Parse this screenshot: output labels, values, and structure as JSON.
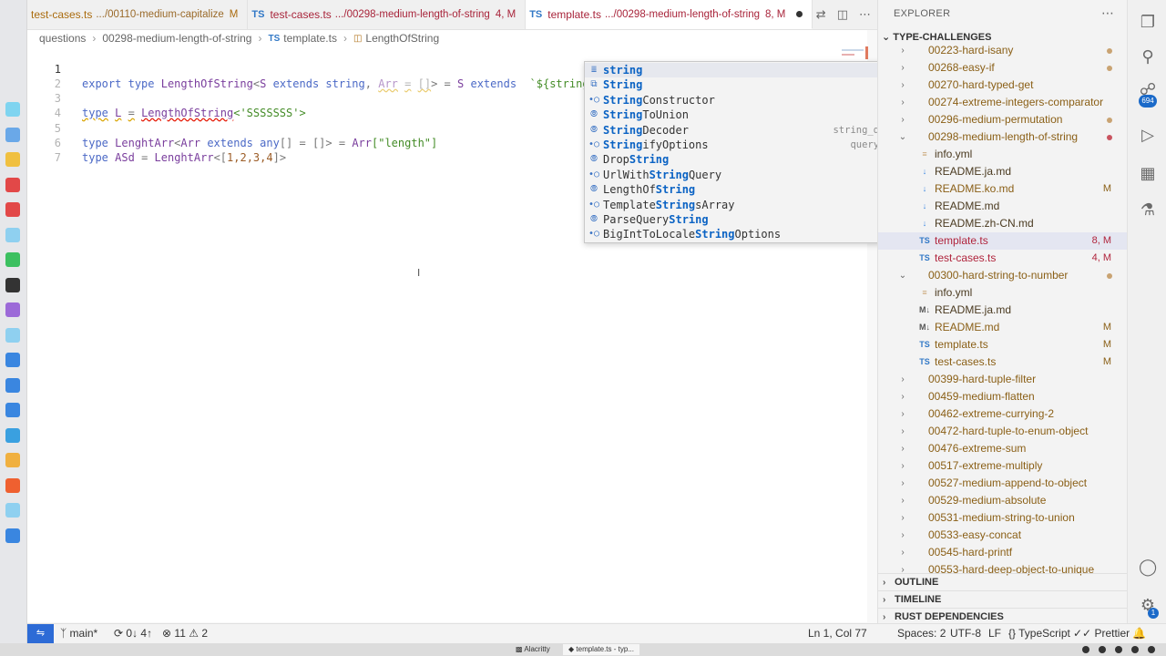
{
  "tabs": [
    {
      "name": "test-cases.ts",
      "path": ".../00110-medium-capitalize",
      "status": "M",
      "active": false
    },
    {
      "name": "test-cases.ts",
      "path": ".../00298-medium-length-of-string",
      "status": "4, M",
      "active": false
    },
    {
      "name": "template.ts",
      "path": ".../00298-medium-length-of-string",
      "status": "8, M",
      "active": true
    }
  ],
  "ts_badge": "TS",
  "breadcrumb": [
    "questions",
    "00298-medium-length-of-string",
    "template.ts",
    "LengthOfString"
  ],
  "editor": {
    "line_numbers": [
      "1",
      "2",
      "3",
      "4",
      "5",
      "6",
      "7"
    ],
    "line1": {
      "export": "export",
      "type": "type",
      "name": "LengthOfString",
      "lt": "<",
      "s": "S",
      "extends": "extends",
      "string": "string",
      "comma": ",",
      "arr": "Arr",
      "eq": "=",
      "brackets": "[]",
      "gt": ">",
      "eq2": "=",
      "s2": "S",
      "extends2": "extends",
      "tpl": "`${string",
      "tick": "`"
    },
    "line3": {
      "type": "type",
      "name": "L",
      "eq": "=",
      "call": "LengthOfString",
      "arg": "<'SSSSSSS'>"
    },
    "line5": {
      "type": "type",
      "name": "LenghtArr",
      "lt": "<",
      "arr": "Arr",
      "extends": "extends",
      "any": "any",
      "rest": "[] = []> = ",
      "arr2": "Arr",
      "idx": "[\"length\"]"
    },
    "line6": {
      "type": "type",
      "name": "ASd",
      "eq": "=",
      "call": "LenghtArr",
      "lt": "<[",
      "nums": "1,2,3,4",
      "gt": "]>"
    }
  },
  "suggestions": [
    {
      "pre": "",
      "bold": "string",
      "post": "",
      "icon": "keyword-icon",
      "detail": ""
    },
    {
      "pre": "",
      "bold": "String",
      "post": "",
      "icon": "interface-icon",
      "detail": ""
    },
    {
      "pre": "",
      "bold": "String",
      "post": "Constructor",
      "icon": "variable-icon",
      "detail": ""
    },
    {
      "pre": "",
      "bold": "String",
      "post": "ToUnion",
      "icon": "type-icon",
      "detail": ""
    },
    {
      "pre": "",
      "bold": "String",
      "post": "Decoder",
      "icon": "type-icon",
      "detail": "string_decoder"
    },
    {
      "pre": "",
      "bold": "String",
      "post": "ifyOptions",
      "icon": "variable-icon",
      "detail": "querystring"
    },
    {
      "pre": "Drop",
      "bold": "String",
      "post": "",
      "icon": "type-icon",
      "detail": ""
    },
    {
      "pre": "UrlWith",
      "bold": "String",
      "post": "Query",
      "icon": "variable-icon",
      "detail": "url"
    },
    {
      "pre": "LengthOf",
      "bold": "String",
      "post": "",
      "icon": "type-icon",
      "detail": ""
    },
    {
      "pre": "Template",
      "bold": "String",
      "post": "sArray",
      "icon": "variable-icon",
      "detail": ""
    },
    {
      "pre": "ParseQuery",
      "bold": "String",
      "post": "",
      "icon": "type-icon",
      "detail": ""
    },
    {
      "pre": "BigIntToLocale",
      "bold": "String",
      "post": "Options",
      "icon": "variable-icon",
      "detail": ""
    }
  ],
  "explorer": {
    "title": "EXPLORER",
    "root": "TYPE-CHALLENGES",
    "items": [
      {
        "label": "00223-hard-isany",
        "kind": "folder",
        "status": "",
        "dot": true
      },
      {
        "label": "00268-easy-if",
        "kind": "folder",
        "status": "",
        "dot": true
      },
      {
        "label": "00270-hard-typed-get",
        "kind": "folder",
        "status": "",
        "dot": false
      },
      {
        "label": "00274-extreme-integers-comparator",
        "kind": "folder",
        "status": "",
        "dot": false
      },
      {
        "label": "00296-medium-permutation",
        "kind": "folder",
        "status": "",
        "dot": true
      },
      {
        "label": "00298-medium-length-of-string",
        "kind": "folder-open",
        "status": "",
        "dot": true
      },
      {
        "label": "info.yml",
        "kind": "yml",
        "status": ""
      },
      {
        "label": "README.ja.md",
        "kind": "md",
        "status": ""
      },
      {
        "label": "README.ko.md",
        "kind": "md",
        "status": "M"
      },
      {
        "label": "README.md",
        "kind": "md",
        "status": ""
      },
      {
        "label": "README.zh-CN.md",
        "kind": "md",
        "status": ""
      },
      {
        "label": "template.ts",
        "kind": "ts",
        "status": "8, M"
      },
      {
        "label": "test-cases.ts",
        "kind": "ts",
        "status": "4, M"
      },
      {
        "label": "00300-hard-string-to-number",
        "kind": "folder-open",
        "status": "",
        "dot": true
      },
      {
        "label": "info.yml",
        "kind": "yml",
        "status": ""
      },
      {
        "label": "README.ja.md",
        "kind": "mdicon",
        "status": ""
      },
      {
        "label": "README.md",
        "kind": "mdicon",
        "status": "M"
      },
      {
        "label": "template.ts",
        "kind": "ts",
        "status": "M"
      },
      {
        "label": "test-cases.ts",
        "kind": "ts",
        "status": "M"
      },
      {
        "label": "00399-hard-tuple-filter",
        "kind": "folder",
        "status": ""
      },
      {
        "label": "00459-medium-flatten",
        "kind": "folder",
        "status": ""
      },
      {
        "label": "00462-extreme-currying-2",
        "kind": "folder",
        "status": ""
      },
      {
        "label": "00472-hard-tuple-to-enum-object",
        "kind": "folder",
        "status": ""
      },
      {
        "label": "00476-extreme-sum",
        "kind": "folder",
        "status": ""
      },
      {
        "label": "00517-extreme-multiply",
        "kind": "folder",
        "status": ""
      },
      {
        "label": "00527-medium-append-to-object",
        "kind": "folder",
        "status": ""
      },
      {
        "label": "00529-medium-absolute",
        "kind": "folder",
        "status": ""
      },
      {
        "label": "00531-medium-string-to-union",
        "kind": "folder",
        "status": ""
      },
      {
        "label": "00533-easy-concat",
        "kind": "folder",
        "status": ""
      },
      {
        "label": "00545-hard-printf",
        "kind": "folder",
        "status": ""
      },
      {
        "label": "00553-hard-deep-object-to-unique",
        "kind": "folder",
        "status": ""
      }
    ],
    "sections": [
      "OUTLINE",
      "TIMELINE",
      "RUST DEPENDENCIES"
    ]
  },
  "activity_badge": "694",
  "settings_badge": "1",
  "status": {
    "branch": "main*",
    "sync": "0↓ 4↑",
    "errors": "11",
    "warnings": "2",
    "position": "Ln 1, Col 77",
    "spaces": "Spaces: 2",
    "encoding": "UTF-8",
    "eol": "LF",
    "language": "TypeScript",
    "formatter": "Prettier"
  },
  "taskbar": {
    "item1": "Alacritty",
    "item2": "template.ts - typ..."
  }
}
